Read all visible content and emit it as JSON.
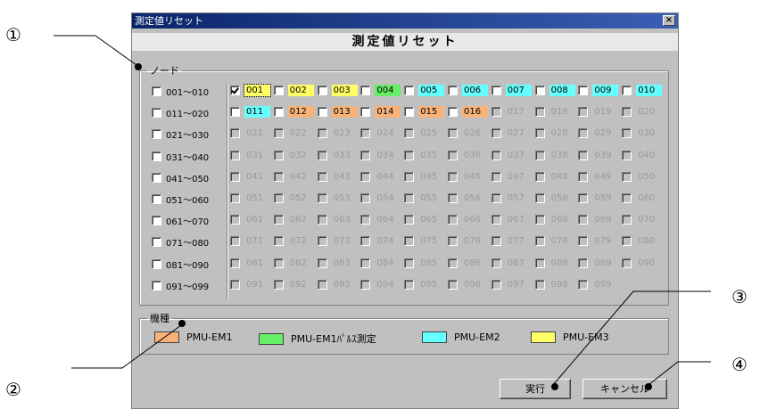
{
  "callouts": [
    "①",
    "②",
    "③",
    "④"
  ],
  "window": {
    "title": "測定値リセット",
    "close_glyph": "×"
  },
  "dialog_title": "測定値リセット",
  "node_group": {
    "label": "ノード",
    "rows": [
      {
        "label": "001～010",
        "checked": false,
        "nodes": [
          {
            "n": "001",
            "enabled": true,
            "checked": true,
            "type": "EM3"
          },
          {
            "n": "002",
            "enabled": true,
            "checked": false,
            "type": "EM3"
          },
          {
            "n": "003",
            "enabled": true,
            "checked": false,
            "type": "EM3"
          },
          {
            "n": "004",
            "enabled": true,
            "checked": false,
            "type": "EM1P"
          },
          {
            "n": "005",
            "enabled": true,
            "checked": false,
            "type": "EM2"
          },
          {
            "n": "006",
            "enabled": true,
            "checked": false,
            "type": "EM2"
          },
          {
            "n": "007",
            "enabled": true,
            "checked": false,
            "type": "EM2"
          },
          {
            "n": "008",
            "enabled": true,
            "checked": false,
            "type": "EM2"
          },
          {
            "n": "009",
            "enabled": true,
            "checked": false,
            "type": "EM2"
          },
          {
            "n": "010",
            "enabled": true,
            "checked": false,
            "type": "EM2"
          }
        ]
      },
      {
        "label": "011～020",
        "checked": false,
        "nodes": [
          {
            "n": "011",
            "enabled": true,
            "checked": false,
            "type": "EM2"
          },
          {
            "n": "012",
            "enabled": true,
            "checked": false,
            "type": "EM1"
          },
          {
            "n": "013",
            "enabled": true,
            "checked": false,
            "type": "EM1"
          },
          {
            "n": "014",
            "enabled": true,
            "checked": false,
            "type": "EM1"
          },
          {
            "n": "015",
            "enabled": true,
            "checked": false,
            "type": "EM1"
          },
          {
            "n": "016",
            "enabled": true,
            "checked": false,
            "type": "EM1"
          },
          {
            "n": "017",
            "enabled": false
          },
          {
            "n": "018",
            "enabled": false
          },
          {
            "n": "019",
            "enabled": false
          },
          {
            "n": "020",
            "enabled": false
          }
        ]
      },
      {
        "label": "021～030",
        "checked": false,
        "nodes": [
          {
            "n": "021",
            "enabled": false
          },
          {
            "n": "022",
            "enabled": false
          },
          {
            "n": "023",
            "enabled": false
          },
          {
            "n": "024",
            "enabled": false
          },
          {
            "n": "025",
            "enabled": false
          },
          {
            "n": "026",
            "enabled": false
          },
          {
            "n": "027",
            "enabled": false
          },
          {
            "n": "028",
            "enabled": false
          },
          {
            "n": "029",
            "enabled": false
          },
          {
            "n": "030",
            "enabled": false
          }
        ]
      },
      {
        "label": "031～040",
        "checked": false,
        "nodes": [
          {
            "n": "031",
            "enabled": false
          },
          {
            "n": "032",
            "enabled": false
          },
          {
            "n": "033",
            "enabled": false
          },
          {
            "n": "034",
            "enabled": false
          },
          {
            "n": "035",
            "enabled": false
          },
          {
            "n": "036",
            "enabled": false
          },
          {
            "n": "037",
            "enabled": false
          },
          {
            "n": "038",
            "enabled": false
          },
          {
            "n": "039",
            "enabled": false
          },
          {
            "n": "040",
            "enabled": false
          }
        ]
      },
      {
        "label": "041～050",
        "checked": false,
        "nodes": [
          {
            "n": "041",
            "enabled": false
          },
          {
            "n": "042",
            "enabled": false
          },
          {
            "n": "043",
            "enabled": false
          },
          {
            "n": "044",
            "enabled": false
          },
          {
            "n": "045",
            "enabled": false
          },
          {
            "n": "046",
            "enabled": false
          },
          {
            "n": "047",
            "enabled": false
          },
          {
            "n": "048",
            "enabled": false
          },
          {
            "n": "049",
            "enabled": false
          },
          {
            "n": "050",
            "enabled": false
          }
        ]
      },
      {
        "label": "051～060",
        "checked": false,
        "nodes": [
          {
            "n": "051",
            "enabled": false
          },
          {
            "n": "052",
            "enabled": false
          },
          {
            "n": "053",
            "enabled": false
          },
          {
            "n": "054",
            "enabled": false
          },
          {
            "n": "055",
            "enabled": false
          },
          {
            "n": "056",
            "enabled": false
          },
          {
            "n": "057",
            "enabled": false
          },
          {
            "n": "058",
            "enabled": false
          },
          {
            "n": "059",
            "enabled": false
          },
          {
            "n": "060",
            "enabled": false
          }
        ]
      },
      {
        "label": "061～070",
        "checked": false,
        "nodes": [
          {
            "n": "061",
            "enabled": false
          },
          {
            "n": "062",
            "enabled": false
          },
          {
            "n": "063",
            "enabled": false
          },
          {
            "n": "064",
            "enabled": false
          },
          {
            "n": "065",
            "enabled": false
          },
          {
            "n": "066",
            "enabled": false
          },
          {
            "n": "067",
            "enabled": false
          },
          {
            "n": "068",
            "enabled": false
          },
          {
            "n": "069",
            "enabled": false
          },
          {
            "n": "070",
            "enabled": false
          }
        ]
      },
      {
        "label": "071～080",
        "checked": false,
        "nodes": [
          {
            "n": "071",
            "enabled": false
          },
          {
            "n": "072",
            "enabled": false
          },
          {
            "n": "073",
            "enabled": false
          },
          {
            "n": "074",
            "enabled": false
          },
          {
            "n": "075",
            "enabled": false
          },
          {
            "n": "076",
            "enabled": false
          },
          {
            "n": "077",
            "enabled": false
          },
          {
            "n": "078",
            "enabled": false
          },
          {
            "n": "079",
            "enabled": false
          },
          {
            "n": "080",
            "enabled": false
          }
        ]
      },
      {
        "label": "081～090",
        "checked": false,
        "nodes": [
          {
            "n": "081",
            "enabled": false
          },
          {
            "n": "082",
            "enabled": false
          },
          {
            "n": "083",
            "enabled": false
          },
          {
            "n": "084",
            "enabled": false
          },
          {
            "n": "085",
            "enabled": false
          },
          {
            "n": "086",
            "enabled": false
          },
          {
            "n": "087",
            "enabled": false
          },
          {
            "n": "088",
            "enabled": false
          },
          {
            "n": "089",
            "enabled": false
          },
          {
            "n": "090",
            "enabled": false
          }
        ]
      },
      {
        "label": "091～099",
        "checked": false,
        "nodes": [
          {
            "n": "091",
            "enabled": false
          },
          {
            "n": "092",
            "enabled": false
          },
          {
            "n": "093",
            "enabled": false
          },
          {
            "n": "094",
            "enabled": false
          },
          {
            "n": "095",
            "enabled": false
          },
          {
            "n": "096",
            "enabled": false
          },
          {
            "n": "097",
            "enabled": false
          },
          {
            "n": "098",
            "enabled": false
          },
          {
            "n": "099",
            "enabled": false
          }
        ]
      }
    ]
  },
  "type_colors": {
    "EM1": "#f7b27a",
    "EM1P": "#66ee66",
    "EM2": "#66ffff",
    "EM3": "#ffff66"
  },
  "model_group": {
    "label": "機種",
    "items": [
      {
        "label": "PMU-EM1",
        "type": "EM1"
      },
      {
        "label": "PMU-EM1ﾊﾟﾙｽ測定",
        "type": "EM1P"
      },
      {
        "label": "PMU-EM2",
        "type": "EM2"
      },
      {
        "label": "PMU-EM3",
        "type": "EM3"
      }
    ]
  },
  "buttons": {
    "execute": "実行",
    "cancel": "キャンセル"
  }
}
